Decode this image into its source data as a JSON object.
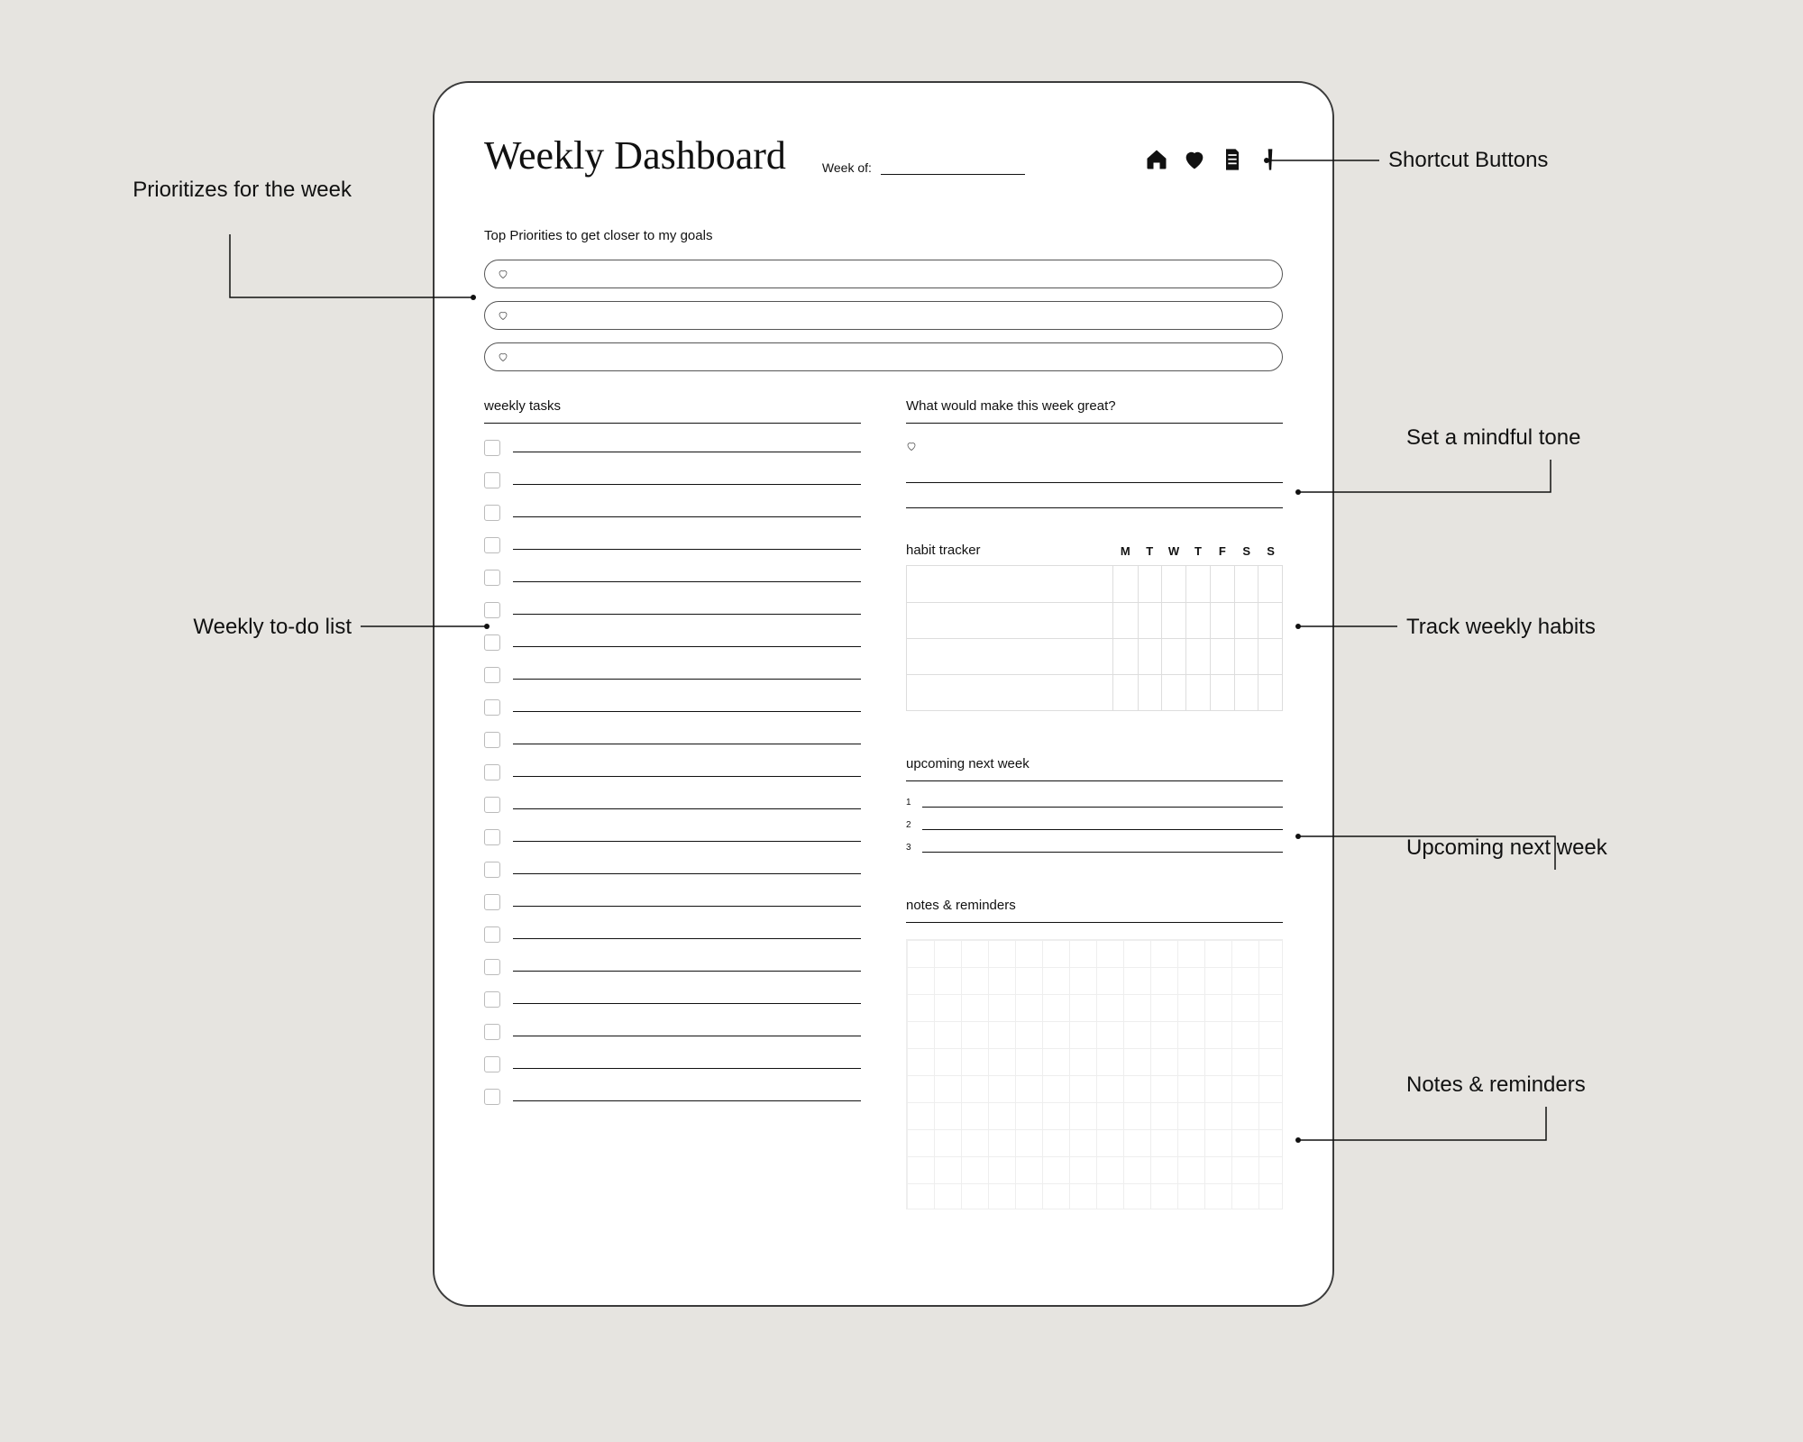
{
  "title": "Weekly Dashboard",
  "week_of_label": "Week of:",
  "priorities": {
    "heading": "Top Priorities to get closer to my goals",
    "rows": 3
  },
  "tasks": {
    "heading": "weekly tasks",
    "rows": 21
  },
  "mindful": {
    "heading": "What would make this week great?",
    "lines": 2
  },
  "habit": {
    "heading": "habit tracker",
    "days": [
      "M",
      "T",
      "W",
      "T",
      "F",
      "S",
      "S"
    ],
    "rows": 4
  },
  "upcoming": {
    "heading": "upcoming next week",
    "rows": [
      "1",
      "2",
      "3"
    ]
  },
  "notes": {
    "heading": "notes & reminders"
  },
  "callouts": {
    "priorities": "Prioritizes for the week",
    "tasks": "Weekly to-do list",
    "shortcuts": "Shortcut Buttons",
    "mindful": "Set a mindful tone",
    "habits": "Track weekly habits",
    "upcoming": "Upcoming next week",
    "notes": "Notes & reminders"
  }
}
